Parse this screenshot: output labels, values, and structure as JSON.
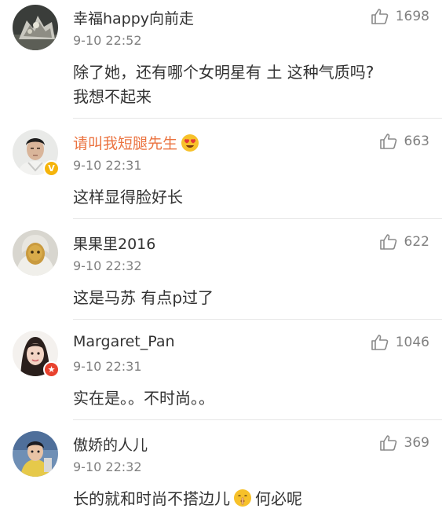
{
  "comments": [
    {
      "username": "幸福happy向前走",
      "timestamp": "9-10 22:52",
      "likes": "1698",
      "content_lines": [
        "除了她，还有哪个女明星有 土 这种气质吗?",
        "我想不起来"
      ],
      "like_icon": "thumbs-up-icon"
    },
    {
      "username": "请叫我短腿先生",
      "timestamp": "9-10 22:31",
      "likes": "663",
      "content_lines": [
        "这样显得脸好长"
      ],
      "name_color": "#eb7340",
      "name_emoji": "heart-eyes-emoji",
      "badge": "vip-badge",
      "like_icon": "thumbs-up-icon"
    },
    {
      "username": "果果里2016",
      "timestamp": "9-10 22:32",
      "likes": "622",
      "content_lines": [
        "这是马苏 有点p过了"
      ],
      "like_icon": "thumbs-up-icon"
    },
    {
      "username": "Margaret_Pan",
      "timestamp": "9-10 22:31",
      "likes": "1046",
      "content_lines": [
        "实在是。。不时尚。。"
      ],
      "badge": "star-badge",
      "like_icon": "thumbs-up-icon"
    },
    {
      "username": "傲娇的人儿",
      "timestamp": "9-10 22:32",
      "likes": "369",
      "content_lines": [
        "长的就和时尚不搭边儿",
        "何必呢"
      ],
      "inline_emoji": "shush-emoji",
      "like_icon": "thumbs-up-icon"
    }
  ],
  "colors": {
    "text": "#333333",
    "muted": "#808080",
    "vip_name": "#eb7340",
    "divider": "#e6e6e6"
  }
}
